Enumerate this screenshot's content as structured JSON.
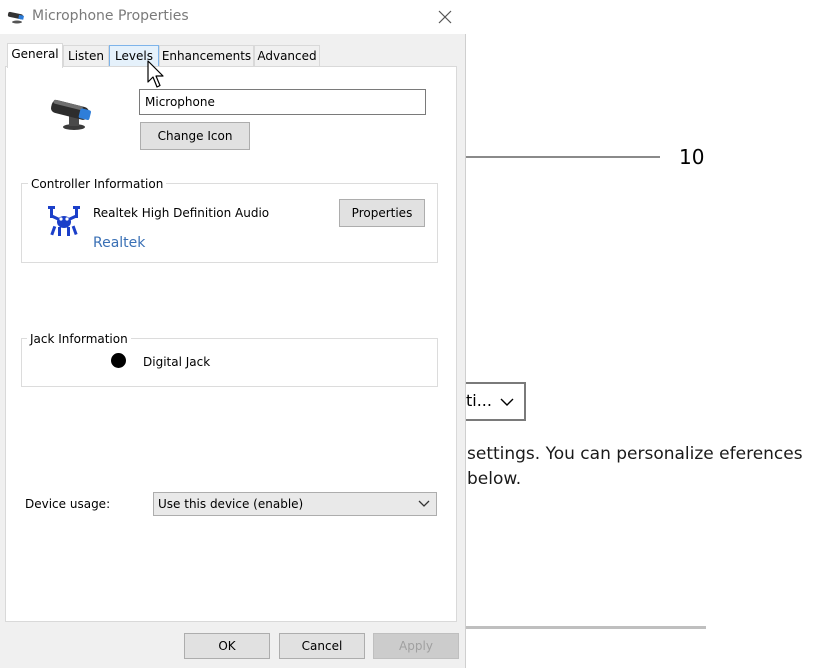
{
  "background": {
    "slider_value": "10",
    "dropdown_text": "ti...",
    "description": "settings. You can personalize eferences below."
  },
  "dialog": {
    "title": "Microphone Properties",
    "tabs": [
      {
        "label": "General"
      },
      {
        "label": "Listen"
      },
      {
        "label": "Levels"
      },
      {
        "label": "Enhancements"
      },
      {
        "label": "Advanced"
      }
    ],
    "device_name": "Microphone",
    "change_icon_label": "Change Icon",
    "controller_group_label": "Controller Information",
    "controller_name": "Realtek High Definition Audio",
    "controller_vendor": "Realtek",
    "properties_label": "Properties",
    "jack_group_label": "Jack Information",
    "jack_text": "Digital Jack",
    "device_usage_label": "Device usage:",
    "device_usage_value": "Use this device (enable)",
    "ok_label": "OK",
    "cancel_label": "Cancel",
    "apply_label": "Apply"
  },
  "colors": {
    "link": "#3a70b5",
    "title_text": "#7a7a7a",
    "tab_hover": "#e5f1fb"
  }
}
